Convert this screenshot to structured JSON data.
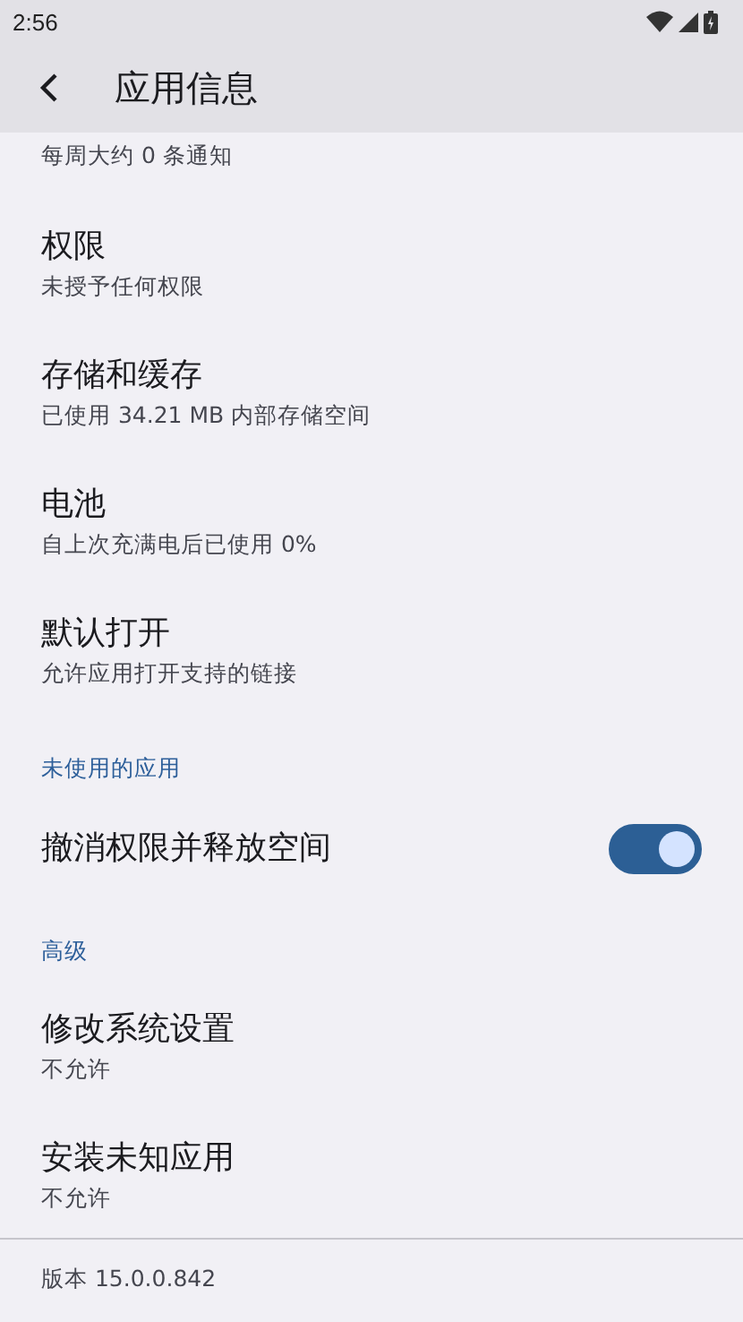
{
  "status_bar": {
    "time": "2:56"
  },
  "app_bar": {
    "title": "应用信息"
  },
  "items": [
    {
      "kind": "partial",
      "subtitle": "每周大约 0 条通知"
    },
    {
      "kind": "setting",
      "title": "权限",
      "subtitle": "未授予任何权限"
    },
    {
      "kind": "setting",
      "title": "存储和缓存",
      "subtitle": "已使用 34.21 MB 内部存储空间"
    },
    {
      "kind": "setting",
      "title": "电池",
      "subtitle": "自上次充满电后已使用 0%"
    },
    {
      "kind": "setting",
      "title": "默认打开",
      "subtitle": "允许应用打开支持的链接"
    },
    {
      "kind": "header",
      "title": "未使用的应用"
    },
    {
      "kind": "switch",
      "title": "撤消权限并释放空间",
      "on": true
    },
    {
      "kind": "header",
      "title": "高级"
    },
    {
      "kind": "setting",
      "title": "修改系统设置",
      "subtitle": "不允许"
    },
    {
      "kind": "setting",
      "title": "安装未知应用",
      "subtitle": "不允许"
    }
  ],
  "footer": {
    "version": "版本 15.0.0.842"
  }
}
